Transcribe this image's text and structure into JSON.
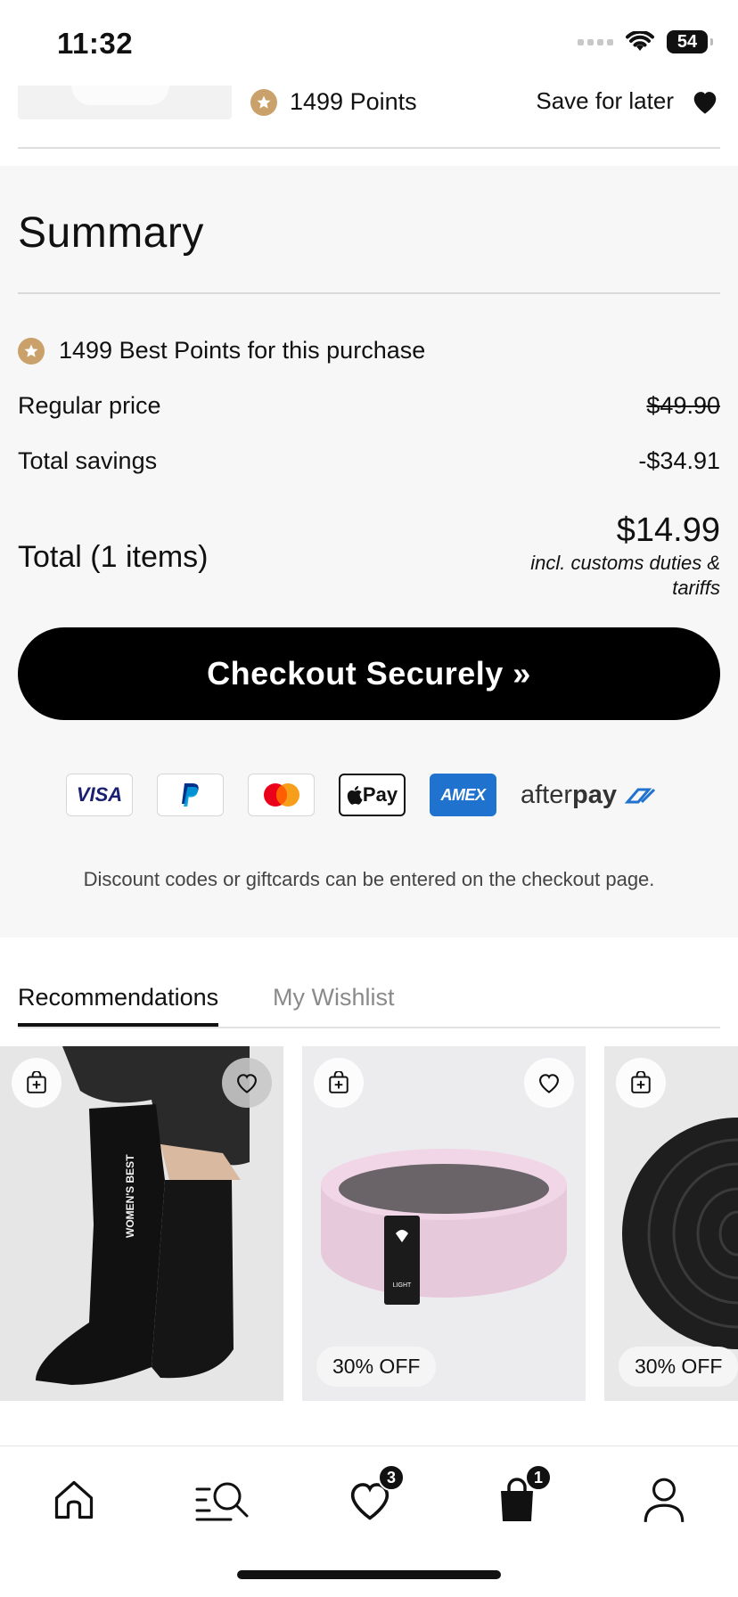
{
  "status_bar": {
    "time": "11:32",
    "battery": "54"
  },
  "cart_item": {
    "points": "1499 Points",
    "save_for_later": "Save for later"
  },
  "summary": {
    "title": "Summary",
    "points_text": "1499 Best Points for this purchase",
    "regular_price_label": "Regular price",
    "regular_price_value": "$49.90",
    "savings_label": "Total savings",
    "savings_value": "-$34.91",
    "total_label": "Total (1 items)",
    "total_value": "$14.99",
    "tax_note": "incl. customs duties & tariffs",
    "checkout_label": "Checkout Securely »",
    "discount_note": "Discount codes or giftcards can be entered on the checkout page."
  },
  "payment_methods": {
    "visa": "VISA",
    "paypal": "paypal-icon",
    "mastercard": "mastercard-icon",
    "apple_pay": "Pay",
    "amex": "AMEX",
    "afterpay_light": "after",
    "afterpay_bold": "pay"
  },
  "tabs": {
    "recommendations": "Recommendations",
    "wishlist": "My Wishlist"
  },
  "products": [
    {
      "image": "black-socks",
      "badge": ""
    },
    {
      "image": "pink-resistance-band",
      "badge": "30% OFF",
      "label": "LIGHT"
    },
    {
      "image": "black-resistance-band",
      "badge": "30% OFF"
    }
  ],
  "sock_text": "WOMEN'S BEST",
  "bottom_nav": {
    "home": "home-icon",
    "search": "search-icon",
    "wishlist_count": "3",
    "cart_count": "1",
    "account": "account-icon"
  },
  "colors": {
    "accent_gold": "#caa16a",
    "primary_black": "#000000",
    "summary_bg": "#f7f7f7",
    "amex_blue": "#1f72cd"
  }
}
